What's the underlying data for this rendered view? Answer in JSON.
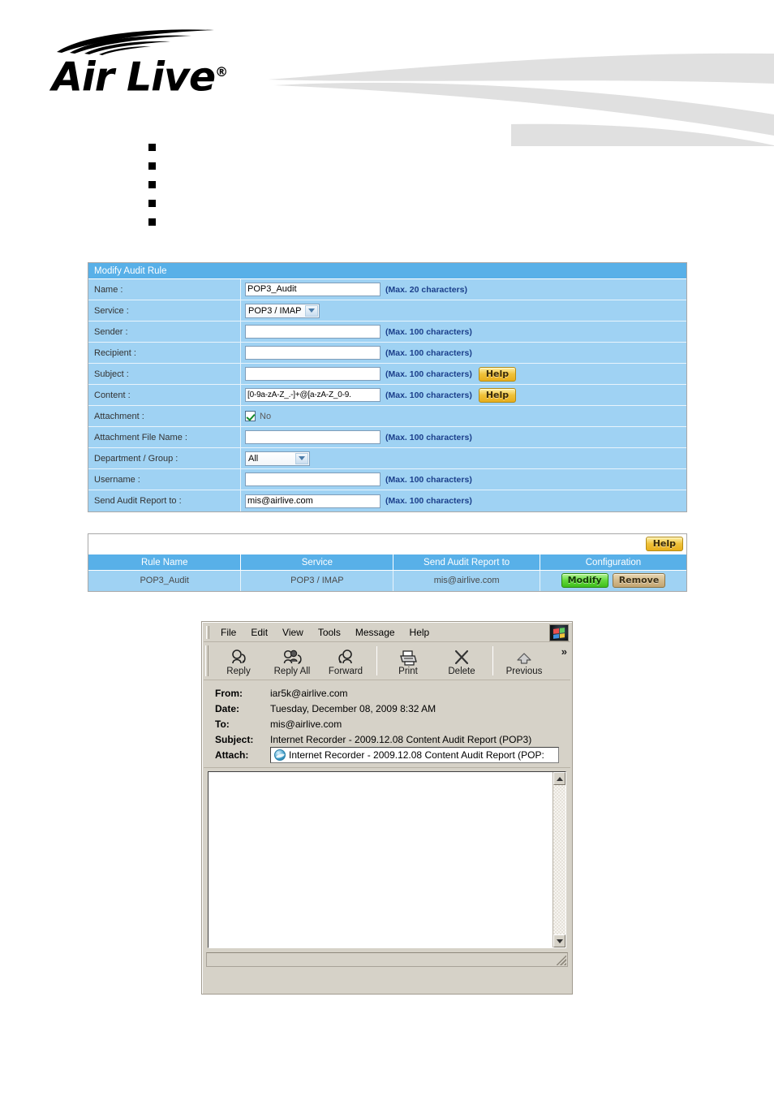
{
  "brand": {
    "name": "Air Live",
    "registered": "®",
    "logo_icon": "wifi-arcs-icon"
  },
  "bullets": [
    {
      "marker": "■",
      "text": ""
    },
    {
      "marker": "■",
      "text": ""
    },
    {
      "marker": "■",
      "text": ""
    },
    {
      "marker": "■",
      "text": ""
    },
    {
      "marker": "■",
      "text": ""
    }
  ],
  "form": {
    "title": "Modify Audit Rule",
    "rows": [
      {
        "label": "Name :",
        "value": "POP3_Audit",
        "hint": "(Max. 20 characters)",
        "help": ""
      },
      {
        "label": "Service :",
        "value": "POP3 / IMAP",
        "hint": "",
        "help": ""
      },
      {
        "label": "Sender :",
        "value": "",
        "hint": "(Max. 100 characters)",
        "help": ""
      },
      {
        "label": "Recipient :",
        "value": "",
        "hint": "(Max. 100 characters)",
        "help": ""
      },
      {
        "label": "Subject :",
        "value": "",
        "hint": "(Max. 100 characters)",
        "help": "Help"
      },
      {
        "label": "Content :",
        "value": "[0-9a-zA-Z_.-]+@[a-zA-Z_0-9.",
        "hint": "(Max. 100 characters)",
        "help": "Help"
      },
      {
        "label": "Attachment :",
        "value": "No",
        "hint": "",
        "help": ""
      },
      {
        "label": "Attachment File Name :",
        "value": "",
        "hint": "(Max. 100 characters)",
        "help": ""
      },
      {
        "label": "Department / Group :",
        "value": "All",
        "hint": "",
        "help": ""
      },
      {
        "label": "Username :",
        "value": "",
        "hint": "(Max. 100 characters)",
        "help": ""
      },
      {
        "label": "Send Audit Report to :",
        "value": "mis@airlive.com",
        "hint": "(Max. 100 characters)",
        "help": ""
      }
    ]
  },
  "rule_list": {
    "help_label": "Help",
    "columns": [
      "Rule Name",
      "Service",
      "Send Audit Report to",
      "Configuration"
    ],
    "rows": [
      {
        "rule_name": "POP3_Audit",
        "service": "POP3 / IMAP",
        "report_to": "mis@airlive.com",
        "modify_label": "Modify",
        "remove_label": "Remove"
      }
    ]
  },
  "mail_window": {
    "menu": [
      "File",
      "Edit",
      "View",
      "Tools",
      "Message",
      "Help"
    ],
    "toolbar": [
      {
        "label": "Reply",
        "icon": "reply-icon"
      },
      {
        "label": "Reply All",
        "icon": "reply-all-icon"
      },
      {
        "label": "Forward",
        "icon": "forward-icon"
      },
      {
        "label": "Print",
        "icon": "printer-icon"
      },
      {
        "label": "Delete",
        "icon": "delete-x-icon"
      },
      {
        "label": "Previous",
        "icon": "up-arrow-icon"
      }
    ],
    "overflow_label": "»",
    "headers": {
      "from_label": "From:",
      "from_value": "iar5k@airlive.com",
      "date_label": "Date:",
      "date_value": "Tuesday, December 08, 2009 8:32 AM",
      "to_label": "To:",
      "to_value": "mis@airlive.com",
      "subject_label": "Subject:",
      "subject_value": "Internet Recorder - 2009.12.08 Content Audit Report (POP3)",
      "attach_label": "Attach:",
      "attach_value": "Internet Recorder - 2009.12.08 Content Audit Report (POP:"
    },
    "body_text": "",
    "status_text": ""
  },
  "colors": {
    "panel_header_blue": "#58b0e8",
    "panel_row_blue": "#9fd2f3",
    "hint_blue": "#1b3f8b",
    "modify_green": "#63d83b",
    "remove_tan": "#d3ba8d",
    "help_gold": "#f0c23a",
    "window_chrome": "#d6d2c8"
  }
}
